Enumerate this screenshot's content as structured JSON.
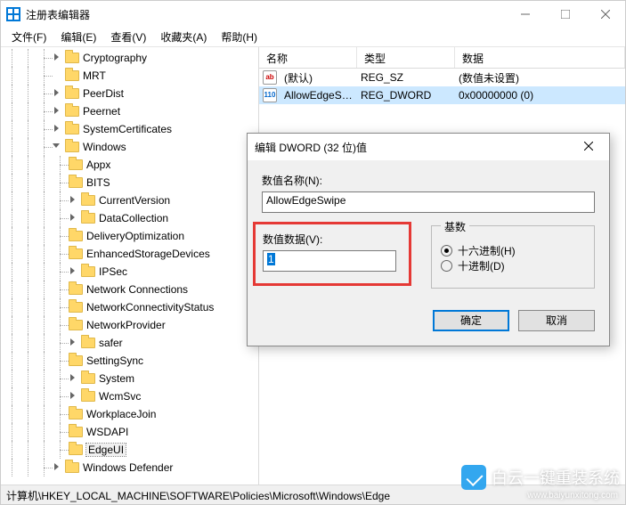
{
  "window": {
    "title": "注册表编辑器"
  },
  "menu": {
    "file": "文件(F)",
    "edit": "编辑(E)",
    "view": "查看(V)",
    "favorites": "收藏夹(A)",
    "help": "帮助(H)"
  },
  "tree": {
    "items": [
      "Cryptography",
      "MRT",
      "PeerDist",
      "Peernet",
      "SystemCertificates",
      "Windows",
      "Appx",
      "BITS",
      "CurrentVersion",
      "DataCollection",
      "DeliveryOptimization",
      "EnhancedStorageDevices",
      "IPSec",
      "Network Connections",
      "NetworkConnectivityStatus",
      "NetworkProvider",
      "safer",
      "SettingSync",
      "System",
      "WcmSvc",
      "WorkplaceJoin",
      "WSDAPI",
      "EdgeUI",
      "Windows Defender"
    ]
  },
  "list": {
    "headers": {
      "name": "名称",
      "type": "类型",
      "data": "数据"
    },
    "rows": [
      {
        "name": "(默认)",
        "type": "REG_SZ",
        "data": "(数值未设置)",
        "icon": "ab"
      },
      {
        "name": "AllowEdgeSwi...",
        "type": "REG_DWORD",
        "data": "0x00000000 (0)",
        "icon": "dw"
      }
    ]
  },
  "dialog": {
    "title": "编辑 DWORD (32 位)值",
    "name_label": "数值名称(N):",
    "name_value": "AllowEdgeSwipe",
    "data_label": "数值数据(V):",
    "data_value": "1",
    "base_label": "基数",
    "hex_label": "十六进制(H)",
    "dec_label": "十进制(D)",
    "ok": "确定",
    "cancel": "取消"
  },
  "statusbar": {
    "path": "计算机\\HKEY_LOCAL_MACHINE\\SOFTWARE\\Policies\\Microsoft\\Windows\\Edge"
  },
  "watermark": {
    "text": "白云一键重装系统",
    "sub": "www.baiyunxitong.com"
  }
}
